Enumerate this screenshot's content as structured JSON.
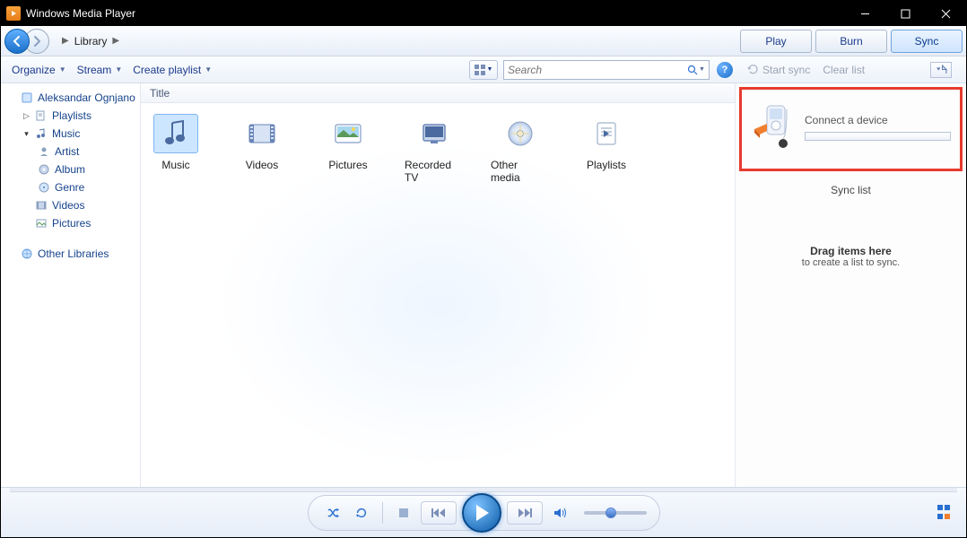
{
  "window": {
    "title": "Windows Media Player"
  },
  "nav": {
    "breadcrumb_root": "Library",
    "tabs": {
      "play": "Play",
      "burn": "Burn",
      "sync": "Sync"
    }
  },
  "toolbar": {
    "organize": "Organize",
    "stream": "Stream",
    "create_playlist": "Create playlist",
    "search_placeholder": "Search",
    "start_sync": "Start sync",
    "clear_list": "Clear list"
  },
  "tree": {
    "user": "Aleksandar Ognjano",
    "playlists": "Playlists",
    "music": "Music",
    "artist": "Artist",
    "album": "Album",
    "genre": "Genre",
    "videos": "Videos",
    "pictures": "Pictures",
    "other_libraries": "Other Libraries"
  },
  "column_header": "Title",
  "library_items": {
    "music": "Music",
    "videos": "Videos",
    "pictures": "Pictures",
    "recorded_tv": "Recorded TV",
    "other_media": "Other media",
    "playlists": "Playlists"
  },
  "rightpane": {
    "connect": "Connect a device",
    "sync_list": "Sync list",
    "drag_bold": "Drag items here",
    "drag_sub": "to create a list to sync."
  }
}
